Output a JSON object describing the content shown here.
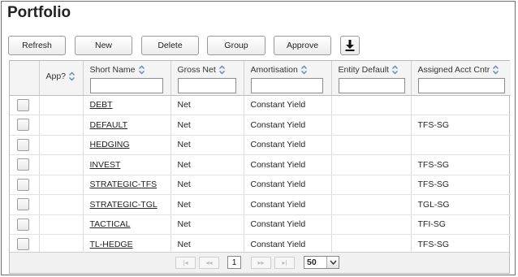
{
  "page": {
    "title": "Portfolio"
  },
  "toolbar": {
    "buttons": [
      {
        "label": "Refresh"
      },
      {
        "label": "New"
      },
      {
        "label": "Delete"
      },
      {
        "label": "Group"
      },
      {
        "label": "Approve"
      }
    ],
    "download_icon": "download-icon"
  },
  "grid": {
    "columns": [
      {
        "label": "App?"
      },
      {
        "label": "Short Name"
      },
      {
        "label": "Gross Net"
      },
      {
        "label": "Amortisation"
      },
      {
        "label": "Entity Default"
      },
      {
        "label": "Assigned Acct Cntr"
      }
    ],
    "filters": [
      "",
      "",
      "",
      "",
      ""
    ],
    "rows": [
      {
        "app": "",
        "short_name": "DEBT",
        "gross_net": "Net",
        "amortisation": "Constant Yield",
        "entity_default": "",
        "acct_cntr": ""
      },
      {
        "app": "",
        "short_name": "DEFAULT",
        "gross_net": "Net",
        "amortisation": "Constant Yield",
        "entity_default": "",
        "acct_cntr": "TFS-SG"
      },
      {
        "app": "",
        "short_name": "HEDGING",
        "gross_net": "Net",
        "amortisation": "Constant Yield",
        "entity_default": "",
        "acct_cntr": ""
      },
      {
        "app": "",
        "short_name": "INVEST",
        "gross_net": "Net",
        "amortisation": "Constant Yield",
        "entity_default": "",
        "acct_cntr": "TFS-SG"
      },
      {
        "app": "",
        "short_name": "STRATEGIC-TFS",
        "gross_net": "Net",
        "amortisation": "Constant Yield",
        "entity_default": "",
        "acct_cntr": "TFS-SG"
      },
      {
        "app": "",
        "short_name": "STRATEGIC-TGL",
        "gross_net": "Net",
        "amortisation": "Constant Yield",
        "entity_default": "",
        "acct_cntr": "TGL-SG"
      },
      {
        "app": "",
        "short_name": "TACTICAL",
        "gross_net": "Net",
        "amortisation": "Constant Yield",
        "entity_default": "",
        "acct_cntr": "TFI-SG"
      },
      {
        "app": "",
        "short_name": "TL-HEDGE",
        "gross_net": "Net",
        "amortisation": "Constant Yield",
        "entity_default": "",
        "acct_cntr": "TFS-SG"
      }
    ]
  },
  "pager": {
    "current_page": "1",
    "page_size": "50",
    "icons": [
      "first-page-icon",
      "previous-page-icon",
      "next-page-icon",
      "last-page-icon"
    ]
  },
  "colors": {
    "sort_icon": "#5a86c2",
    "header_bg": "#f4f4f4",
    "border": "#b9b9b9"
  }
}
